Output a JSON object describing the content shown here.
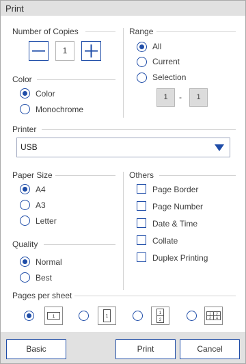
{
  "window": {
    "title": "Print"
  },
  "copies": {
    "label": "Number of Copies",
    "value": "1"
  },
  "range": {
    "label": "Range",
    "options": [
      {
        "label": "All",
        "selected": true
      },
      {
        "label": "Current",
        "selected": false
      },
      {
        "label": "Selection",
        "selected": false
      }
    ],
    "from": "1",
    "separator": "-",
    "to": "1"
  },
  "color": {
    "label": "Color",
    "options": [
      {
        "label": "Color",
        "selected": true
      },
      {
        "label": "Monochrome",
        "selected": false
      }
    ]
  },
  "printer": {
    "label": "Printer",
    "selected": "USB"
  },
  "paper_size": {
    "label": "Paper Size",
    "options": [
      {
        "label": "A4",
        "selected": true
      },
      {
        "label": "A3",
        "selected": false
      },
      {
        "label": "Letter",
        "selected": false
      }
    ]
  },
  "others": {
    "label": "Others",
    "options": [
      {
        "label": "Page Border",
        "checked": false
      },
      {
        "label": "Page Number",
        "checked": false
      },
      {
        "label": "Date & Time",
        "checked": false
      },
      {
        "label": "Collate",
        "checked": false
      },
      {
        "label": "Duplex Printing",
        "checked": false
      }
    ]
  },
  "quality": {
    "label": "Quality",
    "options": [
      {
        "label": "Normal",
        "selected": true
      },
      {
        "label": "Best",
        "selected": false
      }
    ]
  },
  "pages_per_sheet": {
    "label": "Pages per sheet",
    "options": [
      {
        "icon": "one-page-landscape-icon",
        "digits": [
          "1"
        ],
        "selected": true
      },
      {
        "icon": "one-page-portrait-icon",
        "digits": [
          "1"
        ],
        "selected": false
      },
      {
        "icon": "two-pages-icon",
        "digits": [
          "1",
          "2"
        ],
        "selected": false
      },
      {
        "icon": "four-pages-icon",
        "digits": [
          "1",
          "2",
          "3",
          "4"
        ],
        "selected": false
      }
    ]
  },
  "footer": {
    "basic_label": "Basic",
    "print_label": "Print",
    "cancel_label": "Cancel"
  },
  "colors": {
    "accent": "#1f4da8",
    "titlebar_bg": "#e1e1e1",
    "footer_bg": "#e1e1e1",
    "disabled_bg": "#dcdcdc"
  }
}
